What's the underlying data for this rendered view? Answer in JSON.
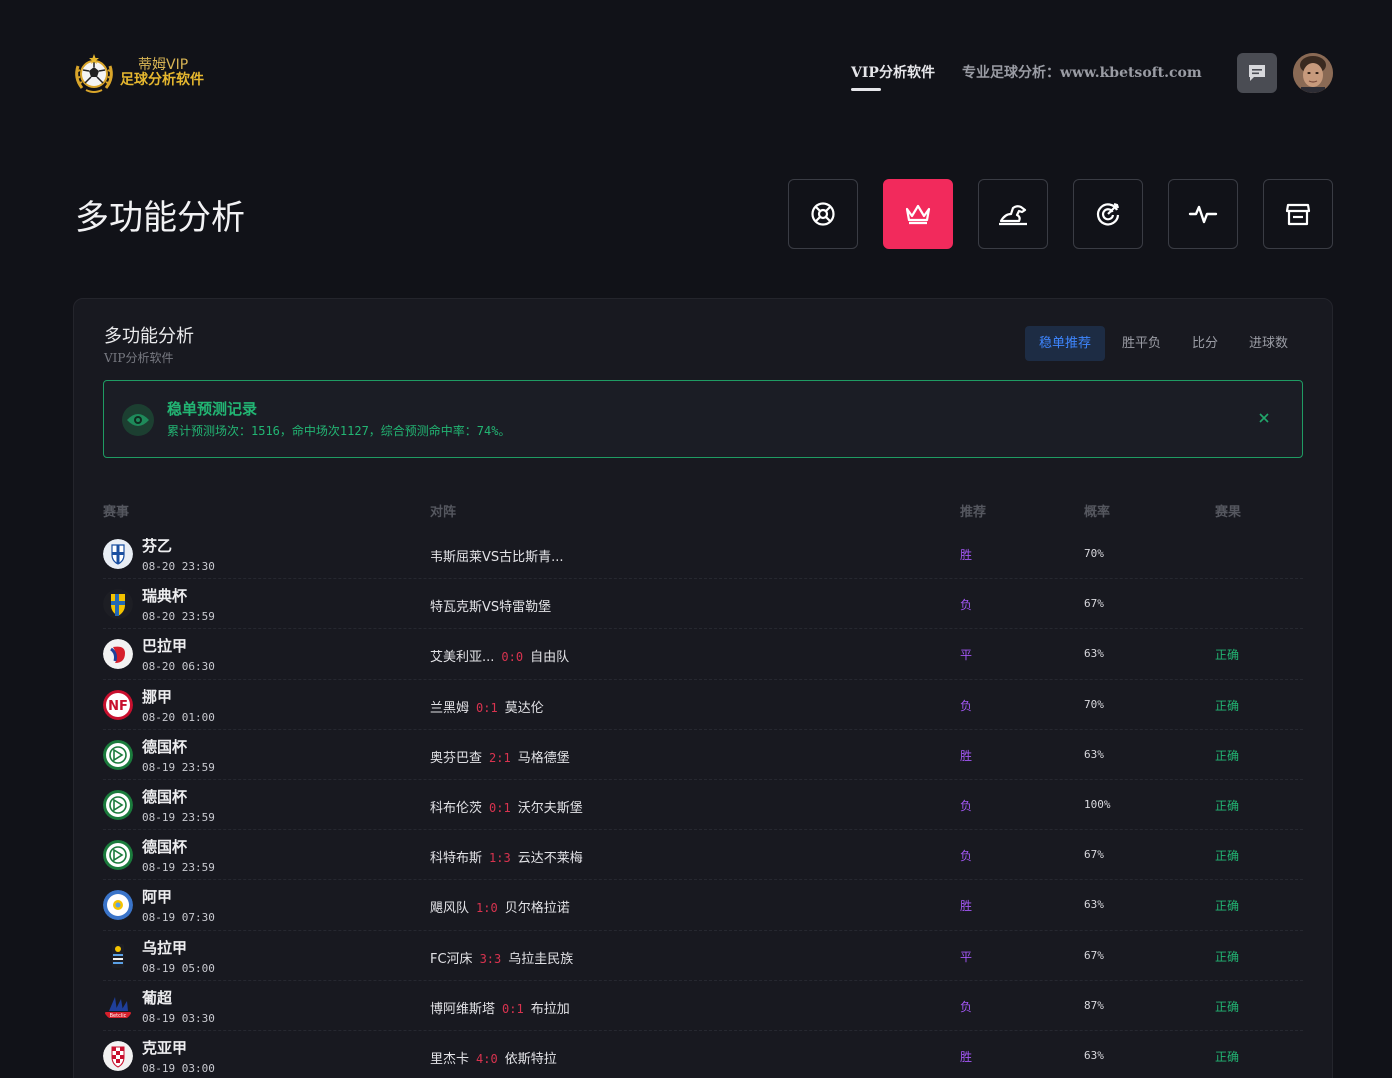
{
  "brand": {
    "line1": "蒂姆VIP",
    "line2": "足球分析软件"
  },
  "nav": {
    "active": "VIP分析软件",
    "link": "专业足球分析：www.kbetsoft.com"
  },
  "page": {
    "title": "多功能分析"
  },
  "quick_icons": [
    {
      "name": "football-icon",
      "active": false
    },
    {
      "name": "crown-icon",
      "active": true
    },
    {
      "name": "horse-icon",
      "active": false
    },
    {
      "name": "target-icon",
      "active": false
    },
    {
      "name": "pulse-icon",
      "active": false
    },
    {
      "name": "store-icon",
      "active": false
    }
  ],
  "panel": {
    "title": "多功能分析",
    "subtitle": "VIP分析软件",
    "tabs": [
      "稳单推荐",
      "胜平负",
      "比分",
      "进球数"
    ],
    "active_tab": "稳单推荐"
  },
  "alert": {
    "title": "稳单预测记录",
    "text": "累计预测场次：1516，命中场次1127，综合预测命中率：74%。"
  },
  "table": {
    "headers": [
      "赛事",
      "对阵",
      "推荐",
      "概率",
      "赛果"
    ],
    "rows": [
      {
        "league": "芬乙",
        "time": "08-20 23:30",
        "home": "韦斯屈莱VS古比斯青...",
        "score": "",
        "away": "",
        "pick": "胜",
        "prob": "70%",
        "result": "",
        "flag": "finland"
      },
      {
        "league": "瑞典杯",
        "time": "08-20 23:59",
        "home": "特瓦克斯VS特雷勒堡",
        "score": "",
        "away": "",
        "pick": "负",
        "prob": "67%",
        "result": "",
        "flag": "sweden"
      },
      {
        "league": "巴拉甲",
        "time": "08-20 06:30",
        "home": "艾美利亚...",
        "score": "0:0",
        "away": "自由队",
        "pick": "平",
        "prob": "63%",
        "result": "正确",
        "flag": "paraguay"
      },
      {
        "league": "挪甲",
        "time": "08-20 01:00",
        "home": "兰黑姆",
        "score": "0:1",
        "away": "莫达伦",
        "pick": "负",
        "prob": "70%",
        "result": "正确",
        "flag": "norway"
      },
      {
        "league": "德国杯",
        "time": "08-19 23:59",
        "home": "奥芬巴查",
        "score": "2:1",
        "away": "马格德堡",
        "pick": "胜",
        "prob": "63%",
        "result": "正确",
        "flag": "germany"
      },
      {
        "league": "德国杯",
        "time": "08-19 23:59",
        "home": "科布伦茨",
        "score": "0:1",
        "away": "沃尔夫斯堡",
        "pick": "负",
        "prob": "100%",
        "result": "正确",
        "flag": "germany"
      },
      {
        "league": "德国杯",
        "time": "08-19 23:59",
        "home": "科特布斯",
        "score": "1:3",
        "away": "云达不莱梅",
        "pick": "负",
        "prob": "67%",
        "result": "正确",
        "flag": "germany"
      },
      {
        "league": "阿甲",
        "time": "08-19 07:30",
        "home": "飓风队",
        "score": "1:0",
        "away": "贝尔格拉诺",
        "pick": "胜",
        "prob": "63%",
        "result": "正确",
        "flag": "argentina"
      },
      {
        "league": "乌拉甲",
        "time": "08-19 05:00",
        "home": "FC河床",
        "score": "3:3",
        "away": "乌拉圭民族",
        "pick": "平",
        "prob": "67%",
        "result": "正确",
        "flag": "uruguay"
      },
      {
        "league": "葡超",
        "time": "08-19 03:30",
        "home": "博阿维斯塔",
        "score": "0:1",
        "away": "布拉加",
        "pick": "负",
        "prob": "87%",
        "result": "正确",
        "flag": "portugal"
      },
      {
        "league": "克亚甲",
        "time": "08-19 03:00",
        "home": "里杰卡",
        "score": "4:0",
        "away": "依斯特拉",
        "pick": "胜",
        "prob": "63%",
        "result": "正确",
        "flag": "croatia"
      }
    ]
  },
  "colors": {
    "accent": "#f22a5c",
    "success": "#22b573",
    "pick": "#a357f5",
    "score": "#d8334f",
    "tab_active": "#3e86ff"
  }
}
